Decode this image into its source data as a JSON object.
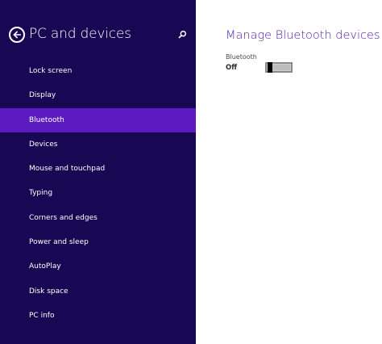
{
  "sidebar": {
    "title": "PC and devices",
    "items": [
      {
        "label": "Lock screen",
        "selected": false
      },
      {
        "label": "Display",
        "selected": false
      },
      {
        "label": "Bluetooth",
        "selected": true
      },
      {
        "label": "Devices",
        "selected": false
      },
      {
        "label": "Mouse and touchpad",
        "selected": false
      },
      {
        "label": "Typing",
        "selected": false
      },
      {
        "label": "Corners and edges",
        "selected": false
      },
      {
        "label": "Power and sleep",
        "selected": false
      },
      {
        "label": "AutoPlay",
        "selected": false
      },
      {
        "label": "Disk space",
        "selected": false
      },
      {
        "label": "PC info",
        "selected": false
      }
    ]
  },
  "main": {
    "title": "Manage Bluetooth devices",
    "setting_label": "Bluetooth",
    "setting_state": "Off",
    "toggle_on": false
  },
  "colors": {
    "sidebar_bg": "#180752",
    "selected_bg": "#5c1bbf",
    "accent_title": "#4f20b3"
  },
  "icons": {
    "back": "back-arrow-icon",
    "search": "search-icon"
  }
}
